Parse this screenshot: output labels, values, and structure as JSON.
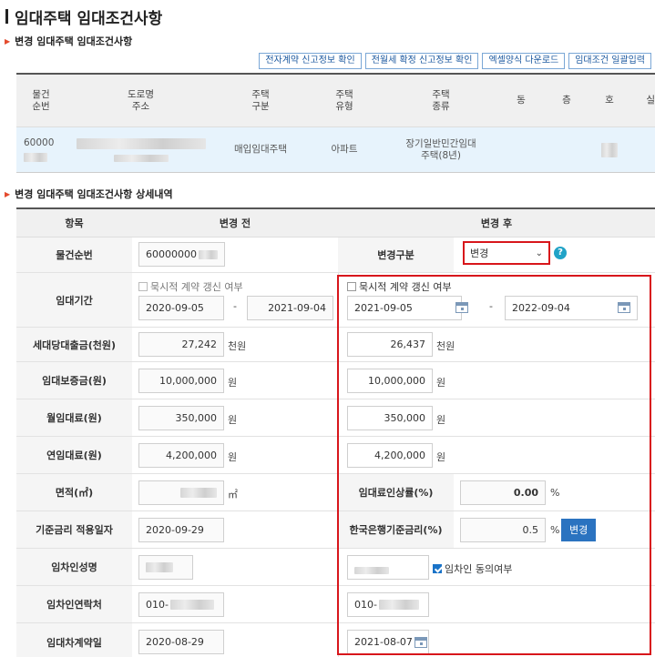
{
  "page_title": "임대주택 임대조건사항",
  "section1_title": "변경 임대주택 임대조건사항",
  "section2_title": "변경 임대주택 임대조건사항 상세내역",
  "buttons": [
    "전자계약 신고정보 확인",
    "전월세 확정 신고정보 확인",
    "엑셀양식 다운로드",
    "임대조건 일괄입력"
  ],
  "top_table": {
    "headers": [
      "물건\n순번",
      "도로명\n주소",
      "주택\n구분",
      "주택\n유형",
      "주택\n종류",
      "동",
      "층",
      "호",
      "실"
    ],
    "row": {
      "seq": "60000",
      "house_class": "매입임대주택",
      "house_type": "아파트",
      "house_kind": "장기일반민간임대\n주택(8년)"
    }
  },
  "detail": {
    "headers": [
      "항목",
      "변경 전",
      "변경 후"
    ],
    "seq": {
      "label": "물건순번",
      "before": "60000000"
    },
    "change_type": {
      "label": "변경구분",
      "value": "변경"
    },
    "period": {
      "label": "임대기간",
      "checkbox_label": "묵시적 계약 갱신 여부",
      "before_start": "2020-09-05",
      "before_end": "2021-09-04",
      "after_start": "2021-09-05",
      "after_end": "2022-09-04"
    },
    "loan": {
      "label": "세대당대출금(천원)",
      "before": "27,242",
      "after": "26,437",
      "unit": "천원"
    },
    "deposit": {
      "label": "임대보증금(원)",
      "before": "10,000,000",
      "after": "10,000,000",
      "unit": "원"
    },
    "monthly": {
      "label": "월임대료(원)",
      "before": "350,000",
      "after": "350,000",
      "unit": "원"
    },
    "yearly": {
      "label": "연임대료(원)",
      "before": "4,200,000",
      "after": "4,200,000",
      "unit": "원"
    },
    "area": {
      "label": "면적(㎡)",
      "unit": "㎡"
    },
    "rate_increase": {
      "label": "임대료인상률(%)",
      "value": "0.00",
      "unit": "%"
    },
    "base_date": {
      "label": "기준금리 적용일자",
      "before": "2020-09-29"
    },
    "bok_rate": {
      "label": "한국은행기준금리(%)",
      "value": "0.5",
      "unit": "%",
      "button": "변경"
    },
    "tenant": {
      "label": "임차인성명",
      "consent_label": "임차인 동의여부"
    },
    "contact": {
      "label": "임차인연락처",
      "before": "010-",
      "after": "010-"
    },
    "contract_date": {
      "label": "임대차계약일",
      "before": "2020-08-29",
      "after": "2021-08-07"
    }
  }
}
